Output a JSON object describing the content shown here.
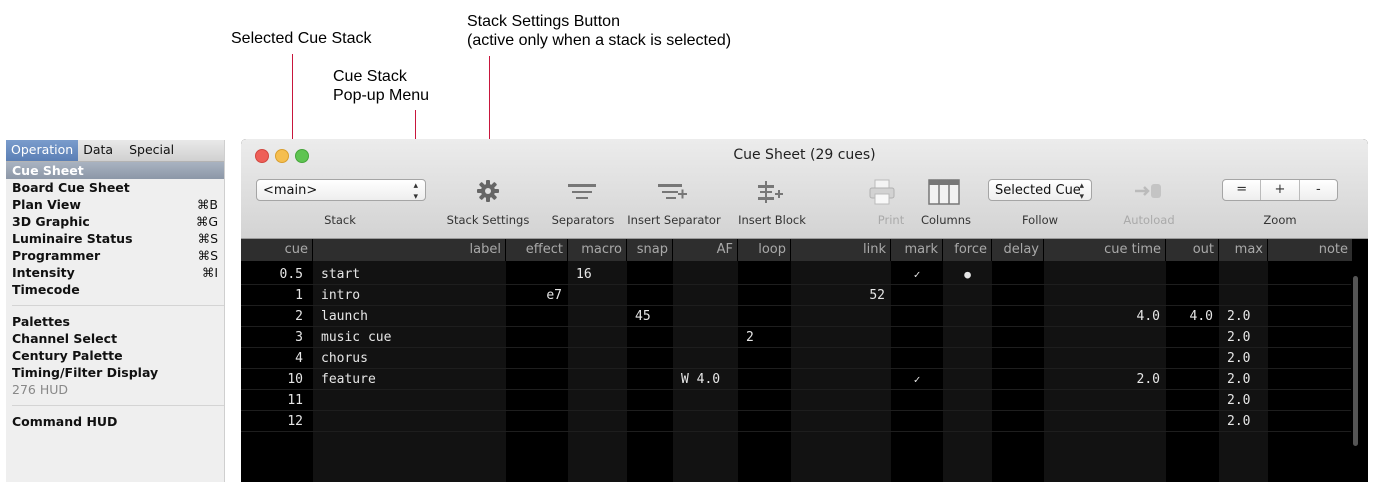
{
  "annotations": {
    "selected_cue_stack": "Selected Cue Stack",
    "cue_stack_popup_1": "Cue Stack",
    "cue_stack_popup_2": "Pop-up Menu",
    "stack_settings_1": "Stack Settings Button",
    "stack_settings_2": "(active only when a stack is selected)"
  },
  "menu": {
    "tabs": [
      "Operation",
      "Data",
      "Special"
    ],
    "items": [
      {
        "label": "Cue Sheet",
        "shortcut": ""
      },
      {
        "label": "Board Cue Sheet",
        "shortcut": ""
      },
      {
        "label": "Plan View",
        "shortcut": "⌘B"
      },
      {
        "label": "3D Graphic",
        "shortcut": "⌘G"
      },
      {
        "label": "Luminaire Status",
        "shortcut": "⌘S"
      },
      {
        "label": "Programmer",
        "shortcut": "⌘S"
      },
      {
        "label": "Intensity",
        "shortcut": "⌘I"
      },
      {
        "label": "Timecode",
        "shortcut": ""
      },
      {
        "label": "Palettes",
        "shortcut": ""
      },
      {
        "label": "Channel Select",
        "shortcut": ""
      },
      {
        "label": "Century Palette",
        "shortcut": ""
      },
      {
        "label": "Timing/Filter Display",
        "shortcut": ""
      },
      {
        "label": "276 HUD",
        "shortcut": ""
      },
      {
        "label": "Command HUD",
        "shortcut": ""
      }
    ]
  },
  "window": {
    "title": "Cue Sheet (29 cues)",
    "stack_popup_value": "<main>",
    "follow_popup_value": "Selected Cue",
    "toolbar_labels": {
      "stack": "Stack",
      "stack_settings": "Stack Settings",
      "separators": "Separators",
      "insert_separator": "Insert Separator",
      "insert_block": "Insert Block",
      "print": "Print",
      "columns": "Columns",
      "follow": "Follow",
      "autoload": "Autoload",
      "zoom": "Zoom"
    },
    "zoom_buttons": [
      "=",
      "+",
      "-"
    ]
  },
  "table": {
    "columns": [
      "cue",
      "label",
      "effect",
      "macro",
      "snap",
      "AF",
      "loop",
      "link",
      "mark",
      "force",
      "delay",
      "cue time",
      "out",
      "max",
      "note"
    ],
    "rows": [
      {
        "cue": "0.5",
        "label": "start",
        "effect": "",
        "macro": "16",
        "snap": "",
        "AF": "",
        "loop": "",
        "link": "",
        "mark": "✓",
        "force": "●",
        "delay": "",
        "cue_time": "",
        "out": "",
        "max": "",
        "note": ""
      },
      {
        "cue": "1",
        "label": "intro",
        "effect": "e7",
        "macro": "",
        "snap": "",
        "AF": "",
        "loop": "",
        "link": "52",
        "mark": "",
        "force": "",
        "delay": "",
        "cue_time": "",
        "out": "",
        "max": "",
        "note": ""
      },
      {
        "cue": "2",
        "label": "launch",
        "effect": "",
        "macro": "",
        "snap": "45",
        "AF": "",
        "loop": "",
        "link": "",
        "mark": "",
        "force": "",
        "delay": "",
        "cue_time": "4.0",
        "out": "4.0",
        "max": "2.0",
        "note": ""
      },
      {
        "cue": "3",
        "label": "music cue",
        "effect": "",
        "macro": "",
        "snap": "",
        "AF": "",
        "loop": "2",
        "link": "",
        "mark": "",
        "force": "",
        "delay": "",
        "cue_time": "",
        "out": "",
        "max": "2.0",
        "note": ""
      },
      {
        "cue": "4",
        "label": "chorus",
        "effect": "",
        "macro": "",
        "snap": "",
        "AF": "",
        "loop": "",
        "link": "",
        "mark": "",
        "force": "",
        "delay": "",
        "cue_time": "",
        "out": "",
        "max": "2.0",
        "note": ""
      },
      {
        "cue": "10",
        "label": "feature",
        "effect": "",
        "macro": "",
        "snap": "",
        "AF": "W 4.0",
        "loop": "",
        "link": "",
        "mark": "✓",
        "force": "",
        "delay": "",
        "cue_time": "2.0",
        "out": "",
        "max": "2.0",
        "note": ""
      },
      {
        "cue": "11",
        "label": "",
        "effect": "",
        "macro": "",
        "snap": "",
        "AF": "",
        "loop": "",
        "link": "",
        "mark": "",
        "force": "",
        "delay": "",
        "cue_time": "",
        "out": "",
        "max": "2.0",
        "note": ""
      },
      {
        "cue": "12",
        "label": "",
        "effect": "",
        "macro": "",
        "snap": "",
        "AF": "",
        "loop": "",
        "link": "",
        "mark": "",
        "force": "",
        "delay": "",
        "cue_time": "",
        "out": "",
        "max": "2.0",
        "note": ""
      }
    ]
  },
  "colors": {
    "annotation_leader": "#c8163c",
    "close": "#ee5f58",
    "minimize": "#f5be4f",
    "zoom": "#5ec451"
  }
}
